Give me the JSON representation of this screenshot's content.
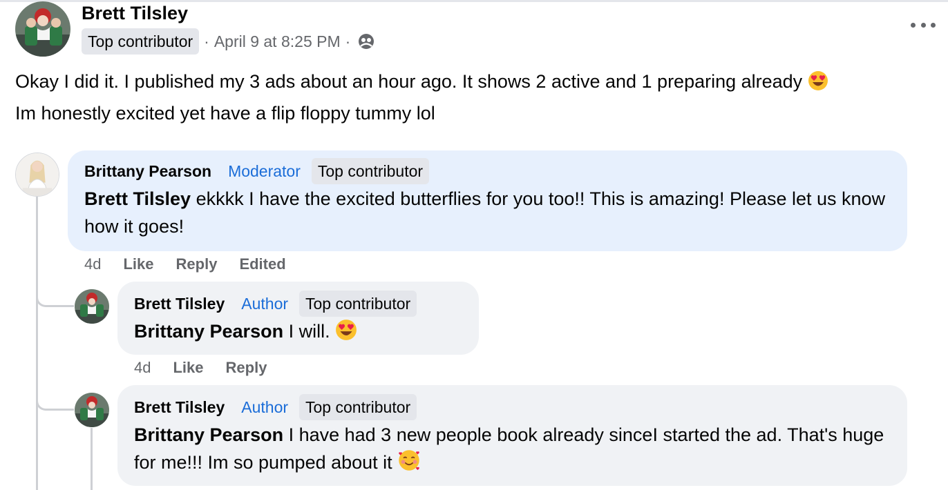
{
  "post": {
    "author": "Brett Tilsley",
    "badge": "Top contributor",
    "sep1": "·",
    "timestamp": "April 9 at 8:25 PM",
    "sep2": "·",
    "line1": "Okay I did it. I published my 3 ads about an hour ago. It shows 2 active and 1 preparing already",
    "line2": "Im honestly excited yet have a flip floppy tummy lol"
  },
  "comments": [
    {
      "author": "Brittany Pearson",
      "role": "Moderator",
      "badge": "Top contributor",
      "mention": "Brett Tilsley",
      "text": " ekkkk I have the excited butterflies for you too!! This is amazing! Please let us know how it goes!",
      "time": "4d",
      "like": "Like",
      "reply": "Reply",
      "edited": "Edited"
    },
    {
      "author": "Brett Tilsley",
      "role": "Author",
      "badge": "Top contributor",
      "mention": "Brittany Pearson",
      "text": " I will. ",
      "time": "4d",
      "like": "Like",
      "reply": "Reply"
    },
    {
      "author": "Brett Tilsley",
      "role": "Author",
      "badge": "Top contributor",
      "mention": "Brittany Pearson",
      "text": " I have had 3 new people book already sinceI started the ad. That's huge for me!!! Im so pumped about it "
    }
  ],
  "icons": {
    "privacy": "group-audience-icon",
    "more": "more-options-icon",
    "emoji_heart_eyes": "heart-eyes-emoji",
    "emoji_hearts": "smiling-face-with-hearts-emoji"
  },
  "colors": {
    "highlight_bubble": "#e7f0fd",
    "bubble": "#f0f2f5",
    "role_blue": "#1b6dd8",
    "meta_gray": "#65676b"
  }
}
